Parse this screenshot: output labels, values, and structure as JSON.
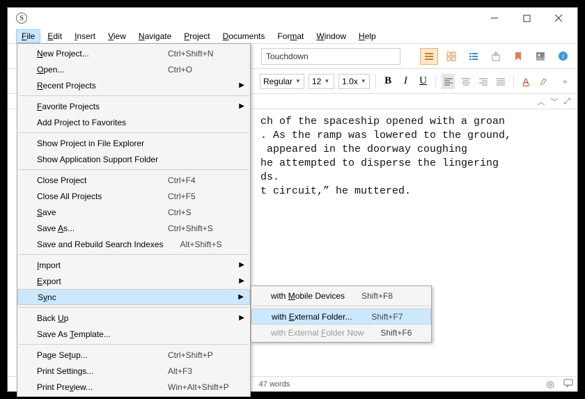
{
  "menubar": [
    "File",
    "Edit",
    "Insert",
    "View",
    "Navigate",
    "Project",
    "Documents",
    "Format",
    "Window",
    "Help"
  ],
  "menubar_ul": [
    0,
    0,
    0,
    0,
    0,
    0,
    0,
    3,
    0,
    0
  ],
  "toolbar1": {
    "title_input": "Touchdown"
  },
  "toolbar2": {
    "font_style": "Regular",
    "font_size": "12",
    "zoom": "1.0x",
    "bold": "B",
    "italic": "I",
    "underline": "U",
    "letterA": "A"
  },
  "editor_text": "ch of the spaceship opened with a groan\n. As the ramp was lowered to the ground,\n appeared in the doorway coughing\nhe attempted to disperse the lingering\nds.\nt circuit,” he muttered.",
  "status": {
    "words": "47 words"
  },
  "file_menu": [
    {
      "label": "New Project...",
      "ul": 0,
      "sc": "Ctrl+Shift+N"
    },
    {
      "label": "Open...",
      "ul": 0,
      "sc": "Ctrl+O"
    },
    {
      "label": "Recent Projects",
      "ul": 0,
      "submenu": true
    },
    {
      "sep": true
    },
    {
      "label": "Favorite Projects",
      "ul": 0,
      "submenu": true
    },
    {
      "label": "Add Project to Favorites"
    },
    {
      "sep": true
    },
    {
      "label": "Show Project in File Explorer"
    },
    {
      "label": "Show Application Support Folder"
    },
    {
      "sep": true
    },
    {
      "label": "Close Project",
      "sc": "Ctrl+F4"
    },
    {
      "label": "Close All Projects",
      "sc": "Ctrl+F5"
    },
    {
      "label": "Save",
      "ul": 0,
      "sc": "Ctrl+S"
    },
    {
      "label": "Save As...",
      "ul": 5,
      "sc": "Ctrl+Shift+S"
    },
    {
      "label": "Save and Rebuild Search Indexes",
      "sc": "Alt+Shift+S"
    },
    {
      "sep": true
    },
    {
      "label": "Import",
      "ul": 0,
      "submenu": true
    },
    {
      "label": "Export",
      "ul": 0,
      "submenu": true
    },
    {
      "label": "Sync",
      "ul": 1,
      "submenu": true,
      "highlight": true
    },
    {
      "sep": true
    },
    {
      "label": "Back Up",
      "ul": 5,
      "submenu": true
    },
    {
      "label": "Save As Template...",
      "ul": 8
    },
    {
      "sep": true
    },
    {
      "label": "Page Setup...",
      "ul": 7,
      "sc": "Ctrl+Shift+P"
    },
    {
      "label": "Print Settings...",
      "sc": "Alt+F3"
    },
    {
      "label": "Print Preview...",
      "ul": 9,
      "sc": "Win+Alt+Shift+P"
    }
  ],
  "sync_menu": [
    {
      "label": "with Mobile Devices",
      "ul": 5,
      "sc": "Shift+F8"
    },
    {
      "sep": true
    },
    {
      "label": "with External Folder...",
      "ul": 5,
      "sc": "Shift+F7",
      "highlight": true
    },
    {
      "label": "with External Folder Now",
      "ul": 14,
      "sc": "Shift+F6",
      "disabled": true
    }
  ]
}
